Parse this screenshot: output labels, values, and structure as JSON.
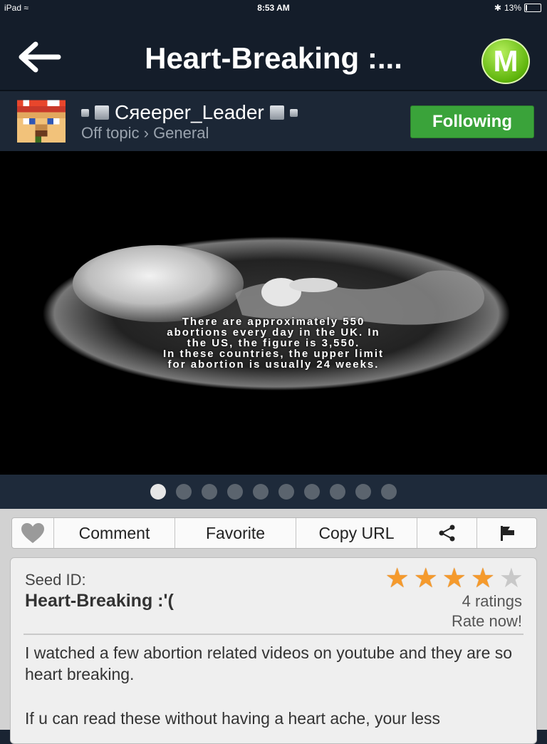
{
  "status_bar": {
    "device": "iPad",
    "time": "8:53 AM",
    "battery": "13%",
    "battery_level": 0.13
  },
  "nav": {
    "title": "Heart-Breaking :...",
    "menu_letter": "M"
  },
  "author": {
    "username": "Cяeeper_Leader",
    "category": "Off topic › General",
    "follow_label": "Following"
  },
  "post_image": {
    "caption_lines": [
      "There are approximately 550",
      "abortions every day in the UK.  In",
      "the US, the figure is 3,550.",
      "In these countries, the upper limit",
      "for abortion is usually 24 weeks."
    ]
  },
  "pager": {
    "count": 10,
    "active_index": 0
  },
  "actions": {
    "comment": "Comment",
    "favorite": "Favorite",
    "copy_url": "Copy URL"
  },
  "seed": {
    "label": "Seed ID:",
    "title": "Heart-Breaking :'(",
    "rating": 4,
    "rating_max": 5,
    "ratings_text": "4 ratings",
    "rate_now": "Rate now!",
    "body": [
      "I watched a few abortion related videos on youtube and they are so heart breaking.",
      "If u can read these without having a heart ache, your less"
    ]
  },
  "colors": {
    "nav_bg": "#141d2a",
    "follow_green": "#3aa33a",
    "star_orange": "#f59a2c"
  }
}
